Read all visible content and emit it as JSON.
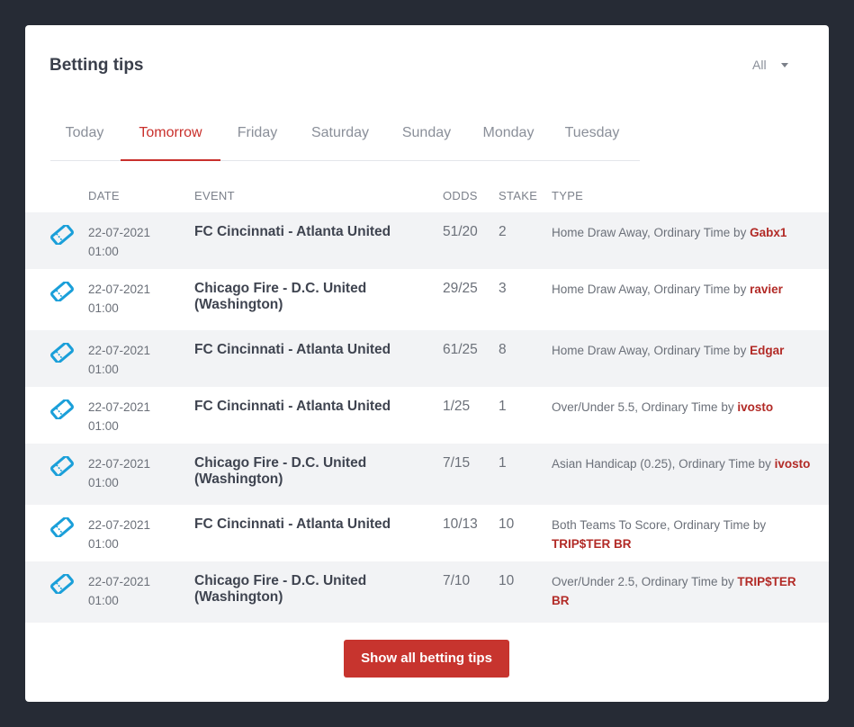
{
  "card": {
    "title": "Betting tips",
    "filter_label": "All"
  },
  "tabs": [
    {
      "label": "Today"
    },
    {
      "label": "Tomorrow"
    },
    {
      "label": "Friday"
    },
    {
      "label": "Saturday"
    },
    {
      "label": "Sunday"
    },
    {
      "label": "Monday"
    },
    {
      "label": "Tuesday"
    }
  ],
  "active_tab": "Tomorrow",
  "columns": {
    "date": "DATE",
    "event": "EVENT",
    "odds": "ODDS",
    "stake": "STAKE",
    "type": "TYPE"
  },
  "rows": [
    {
      "date": "22-07-2021",
      "time": "01:00",
      "event": "FC Cincinnati - Atlanta United",
      "odds": "51/20",
      "stake": "2",
      "type": "Home Draw Away, Ordinary Time by",
      "user": "Gabx1"
    },
    {
      "date": "22-07-2021",
      "time": "01:00",
      "event": "Chicago Fire - D.C. United (Washington)",
      "odds": "29/25",
      "stake": "3",
      "type": "Home Draw Away, Ordinary Time by",
      "user": "ravier"
    },
    {
      "date": "22-07-2021",
      "time": "01:00",
      "event": "FC Cincinnati - Atlanta United",
      "odds": "61/25",
      "stake": "8",
      "type": "Home Draw Away, Ordinary Time by",
      "user": "Edgar"
    },
    {
      "date": "22-07-2021",
      "time": "01:00",
      "event": "FC Cincinnati - Atlanta United",
      "odds": "1/25",
      "stake": "1",
      "type": "Over/Under 5.5, Ordinary Time by",
      "user": "ivosto"
    },
    {
      "date": "22-07-2021",
      "time": "01:00",
      "event": "Chicago Fire - D.C. United (Washington)",
      "odds": "7/15",
      "stake": "1",
      "type": "Asian Handicap (0.25), Ordinary Time by",
      "user": "ivosto"
    },
    {
      "date": "22-07-2021",
      "time": "01:00",
      "event": "FC Cincinnati - Atlanta United",
      "odds": "10/13",
      "stake": "10",
      "type": "Both Teams To Score, Ordinary Time by",
      "user": "TRIP$TER BR"
    },
    {
      "date": "22-07-2021",
      "time": "01:00",
      "event": "Chicago Fire - D.C. United (Washington)",
      "odds": "7/10",
      "stake": "10",
      "type": "Over/Under 2.5, Ordinary Time by",
      "user": "TRIP$TER BR"
    }
  ],
  "button": {
    "label": "Show all betting tips"
  },
  "icons": {
    "row_icon": "ticket-icon",
    "filter_icon": "caret-down-icon"
  },
  "colors": {
    "accent": "#c9302c",
    "icon": "#1a9fd9",
    "background": "#262b35"
  }
}
